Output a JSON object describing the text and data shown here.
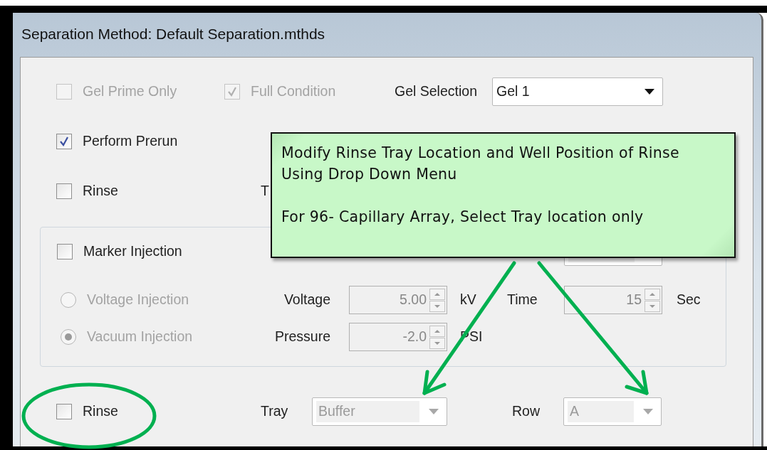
{
  "window": {
    "title": "Separation Method: Default Separation.mthds"
  },
  "options": [
    {
      "label": "Gel Prime Only",
      "checked": false,
      "disabled": true
    },
    {
      "label": "Full Condition",
      "checked": true,
      "disabled": true
    }
  ],
  "gel_selection": {
    "label": "Gel Selection",
    "value": "Gel 1",
    "disabled": false
  },
  "perform_prerun": {
    "label": "Perform Prerun",
    "checked": true,
    "disabled": false
  },
  "rinse_top": {
    "label": "Rinse",
    "checked": false,
    "disabled": false,
    "tray_label": "T"
  },
  "marker_injection": {
    "label": "Marker Injection",
    "checked": false,
    "disabled": false,
    "row_disabled": true,
    "modes": [
      {
        "label": "Voltage Injection",
        "selected": false,
        "disabled": true
      },
      {
        "label": "Vacuum Injection",
        "selected": true,
        "disabled": true
      }
    ],
    "fields": [
      {
        "label": "Voltage",
        "value": "5.00",
        "unit": "kV",
        "disabled": true,
        "label2": "Time",
        "value2": "15",
        "unit2": "Sec"
      },
      {
        "label": "Pressure",
        "value": "-2.0",
        "unit": "PSI",
        "disabled": true
      }
    ]
  },
  "rinse": {
    "label": "Rinse",
    "checked": false,
    "disabled": false,
    "tray_label": "Tray",
    "tray_value": "Buffer",
    "row_label": "Row",
    "row_value": "A",
    "fields_disabled": true
  },
  "callout": {
    "paragraphs": [
      "Modify Rinse Tray Location and Well Position of Rinse Using Drop Down Menu",
      "For 96- Capillary Array, Select Tray location only"
    ]
  }
}
